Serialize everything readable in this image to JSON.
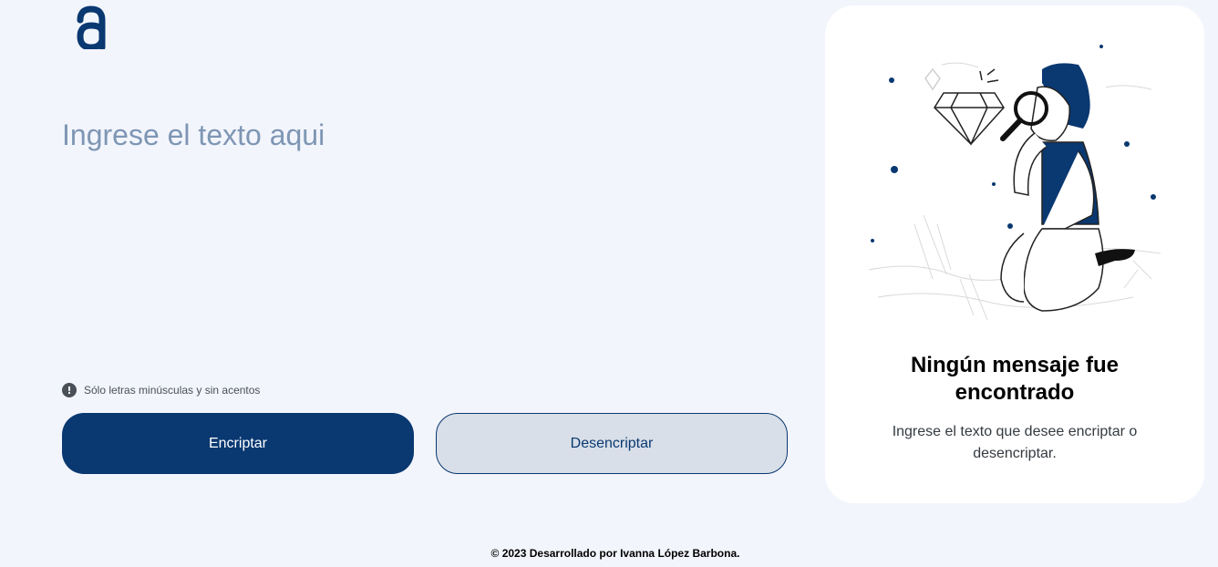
{
  "logo": {
    "icon": "alura-logo-icon",
    "color": "#0a3871"
  },
  "input": {
    "placeholder": "Ingrese el texto aqui",
    "value": ""
  },
  "hint": {
    "icon": "exclamation-circle-icon",
    "text": "Sólo letras minúsculas y sin acentos"
  },
  "buttons": {
    "encrypt_label": "Encriptar",
    "decrypt_label": "Desencriptar"
  },
  "output": {
    "illustration": "boy-with-magnifier-illustration",
    "title": "Ningún mensaje fue encontrado",
    "text": "Ingrese el texto que desee encriptar o desencriptar."
  },
  "footer": {
    "text": "© 2023 Desarrollado por Ivanna López Barbona."
  },
  "colors": {
    "accent": "#0a3871",
    "background": "#f3f5fc",
    "placeholder": "#7e96b4",
    "secondary_button": "#d8dfe8"
  }
}
